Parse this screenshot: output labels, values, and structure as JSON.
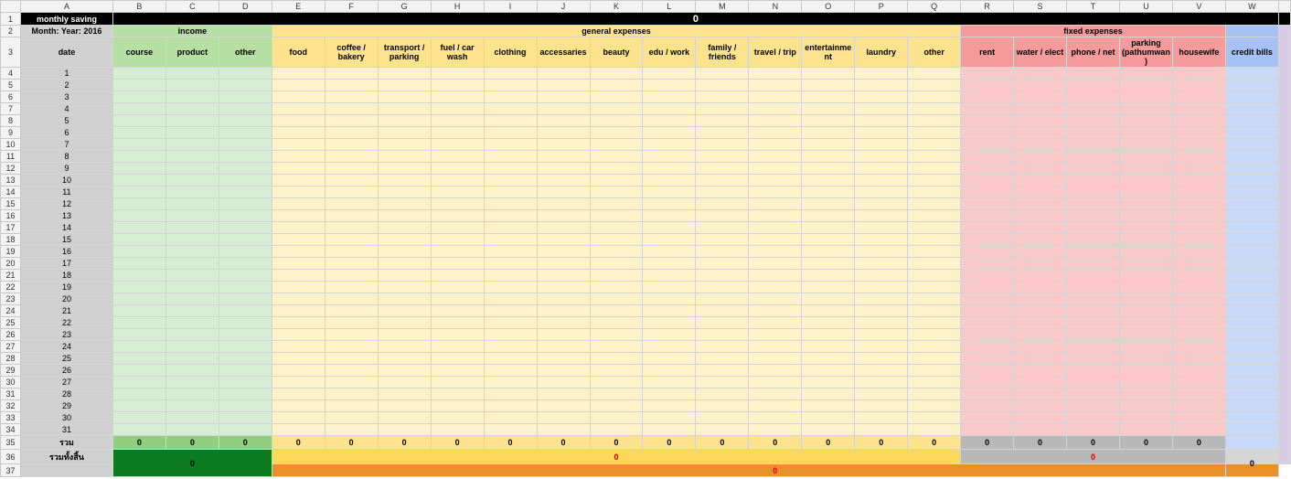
{
  "column_letters": [
    "A",
    "B",
    "C",
    "D",
    "E",
    "F",
    "G",
    "H",
    "I",
    "J",
    "K",
    "L",
    "M",
    "N",
    "O",
    "P",
    "Q",
    "R",
    "S",
    "T",
    "U",
    "V",
    "W"
  ],
  "row1": {
    "title": "monthly saving",
    "total": "0"
  },
  "row2": {
    "month_label": "Month: Year: 2016",
    "income": "income",
    "general": "general expenses",
    "fixed": "fixed expenses"
  },
  "row3": {
    "date": "date",
    "credit": "credit bills",
    "income_cols": [
      "course",
      "product",
      "other"
    ],
    "general_cols": [
      "food",
      "coffee / bakery",
      "transport / parking",
      "fuel / car wash",
      "clothing",
      "accessaries",
      "beauty",
      "edu / work",
      "family / friends",
      "travel / trip",
      "entertainme nt",
      "laundry",
      "other"
    ],
    "fixed_cols": [
      "rent",
      "water / elect",
      "phone / net",
      "parking (pathumwan )",
      "housewife"
    ]
  },
  "dates": [
    "1",
    "2",
    "3",
    "4",
    "5",
    "6",
    "7",
    "8",
    "9",
    "10",
    "11",
    "12",
    "13",
    "14",
    "15",
    "16",
    "17",
    "18",
    "19",
    "20",
    "21",
    "22",
    "23",
    "24",
    "25",
    "26",
    "27",
    "28",
    "29",
    "30",
    "31"
  ],
  "row35": {
    "label": "รวม",
    "income": [
      "0",
      "0",
      "0"
    ],
    "general": [
      "0",
      "0",
      "0",
      "0",
      "0",
      "0",
      "0",
      "0",
      "0",
      "0",
      "0",
      "0",
      "0"
    ],
    "fixed": [
      "0",
      "0",
      "0",
      "0",
      "0"
    ],
    "credit": "0"
  },
  "row36": {
    "label": "รวมทั้งสิ้น",
    "income_total": "0",
    "general_total": "0",
    "fixed_total": "0"
  },
  "row37": {
    "grand_total": "0"
  },
  "colors": {
    "income": "#b6dfa4",
    "general": "#fde38e",
    "fixed": "#f49a9a",
    "credit": "#a6c2f5",
    "grand": "#e8912a"
  }
}
